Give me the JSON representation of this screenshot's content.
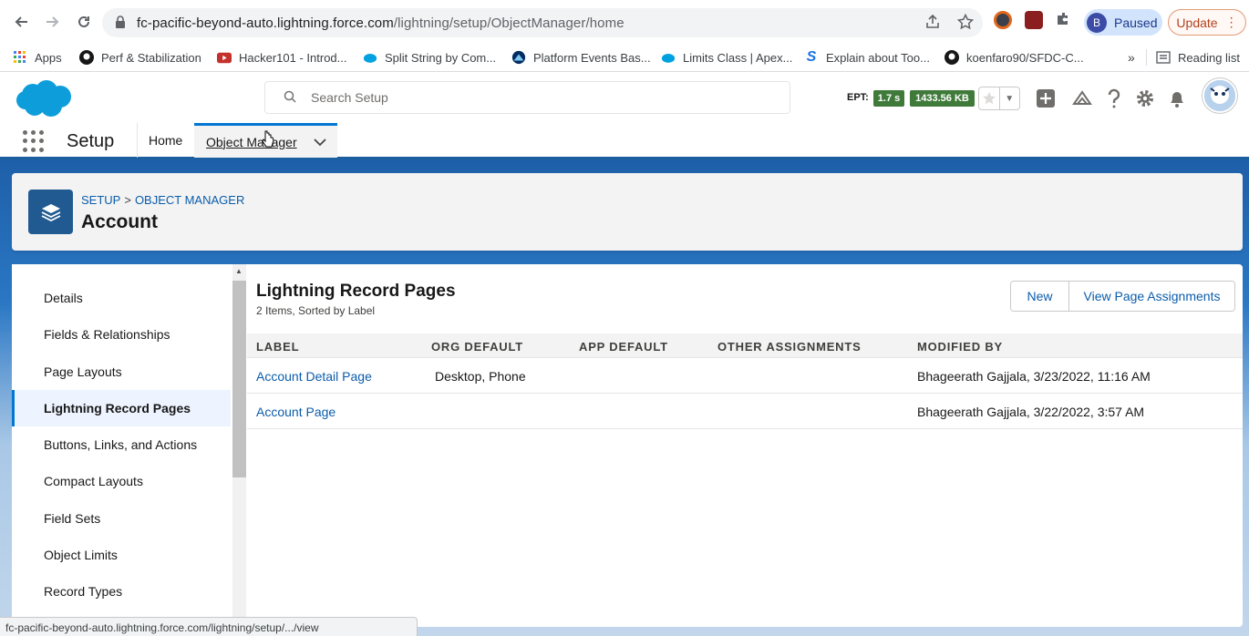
{
  "browser": {
    "url_host": "fc-pacific-beyond-auto.lightning.force.com",
    "url_path": "/lightning/setup/ObjectManager/home",
    "profile_initial": "B",
    "profile_status": "Paused",
    "update_label": "Update"
  },
  "bookmarks": [
    {
      "label": "Apps",
      "icon": "apps-grid-icon"
    },
    {
      "label": "Perf & Stabilization",
      "icon": "github-icon"
    },
    {
      "label": "Hacker101 - Introd...",
      "icon": "youtube-icon"
    },
    {
      "label": "Split String by Com...",
      "icon": "salesforce-cloud-icon"
    },
    {
      "label": "Platform Events Bas...",
      "icon": "trailhead-icon"
    },
    {
      "label": "Limits Class | Apex...",
      "icon": "salesforce-cloud-icon"
    },
    {
      "label": "Explain about Too...",
      "icon": "s-logo-icon"
    },
    {
      "label": "koenfaro90/SFDC-C...",
      "icon": "github-icon"
    }
  ],
  "bookmarks_overflow": "»",
  "reading_list": "Reading list",
  "sf_header": {
    "search_placeholder": "Search Setup",
    "ept_label": "EPT:",
    "ept_time": "1.7 s",
    "ept_size": "1433.56 KB"
  },
  "setup_nav": {
    "app_name": "Setup",
    "tabs": [
      {
        "label": "Home"
      },
      {
        "label": "Object Manager"
      }
    ]
  },
  "page_header": {
    "breadcrumb": [
      "SETUP",
      "OBJECT MANAGER"
    ],
    "breadcrumb_sep": ">",
    "title": "Account"
  },
  "sidebar": {
    "items": [
      {
        "label": "Details"
      },
      {
        "label": "Fields & Relationships"
      },
      {
        "label": "Page Layouts"
      },
      {
        "label": "Lightning Record Pages",
        "active": true
      },
      {
        "label": "Buttons, Links, and Actions"
      },
      {
        "label": "Compact Layouts"
      },
      {
        "label": "Field Sets"
      },
      {
        "label": "Object Limits"
      },
      {
        "label": "Record Types"
      }
    ]
  },
  "panel": {
    "title": "Lightning Record Pages",
    "subtitle": "2 Items, Sorted by Label",
    "new_button": "New",
    "view_assignments_button": "View Page Assignments",
    "columns": [
      "LABEL",
      "ORG DEFAULT",
      "APP DEFAULT",
      "OTHER ASSIGNMENTS",
      "MODIFIED BY"
    ],
    "rows": [
      {
        "label": "Account Detail Page",
        "org_default": "Desktop, Phone",
        "app_default": "",
        "other_assignments": "",
        "modified_by": "Bhageerath Gajjala, 3/23/2022, 11:16 AM"
      },
      {
        "label": "Account Page",
        "org_default": "",
        "app_default": "",
        "other_assignments": "",
        "modified_by": "Bhageerath Gajjala, 3/22/2022, 3:57 AM"
      }
    ]
  },
  "status_bar": "fc-pacific-beyond-auto.lightning.force.com/lightning/setup/.../view",
  "colors": {
    "brand_blue": "#0176d3",
    "link": "#0b5cab",
    "ept_green": "#3f7a3a"
  }
}
